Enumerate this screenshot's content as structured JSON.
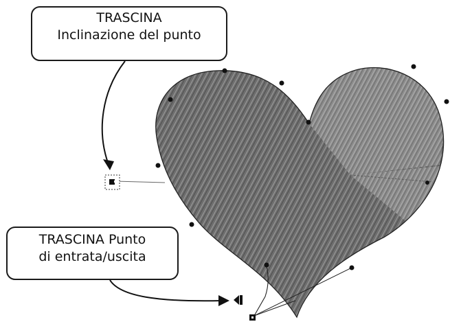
{
  "callouts": {
    "stitch_angle": {
      "line1": "TRASCINA",
      "line2": "Inclinazione del punto"
    },
    "entry_exit": {
      "line1": "TRASCINA Punto",
      "line2": "di entrata/uscita"
    }
  },
  "colors": {
    "stitch_dark": "#6f6f6f",
    "stitch_light": "#8e8e8e",
    "outline": "#222222",
    "callout_border": "#1a1a1a"
  },
  "icons": {
    "angle_handle": "angle-handle-icon",
    "entry_point": "entry-point-icon",
    "exit_point": "exit-point-icon"
  }
}
